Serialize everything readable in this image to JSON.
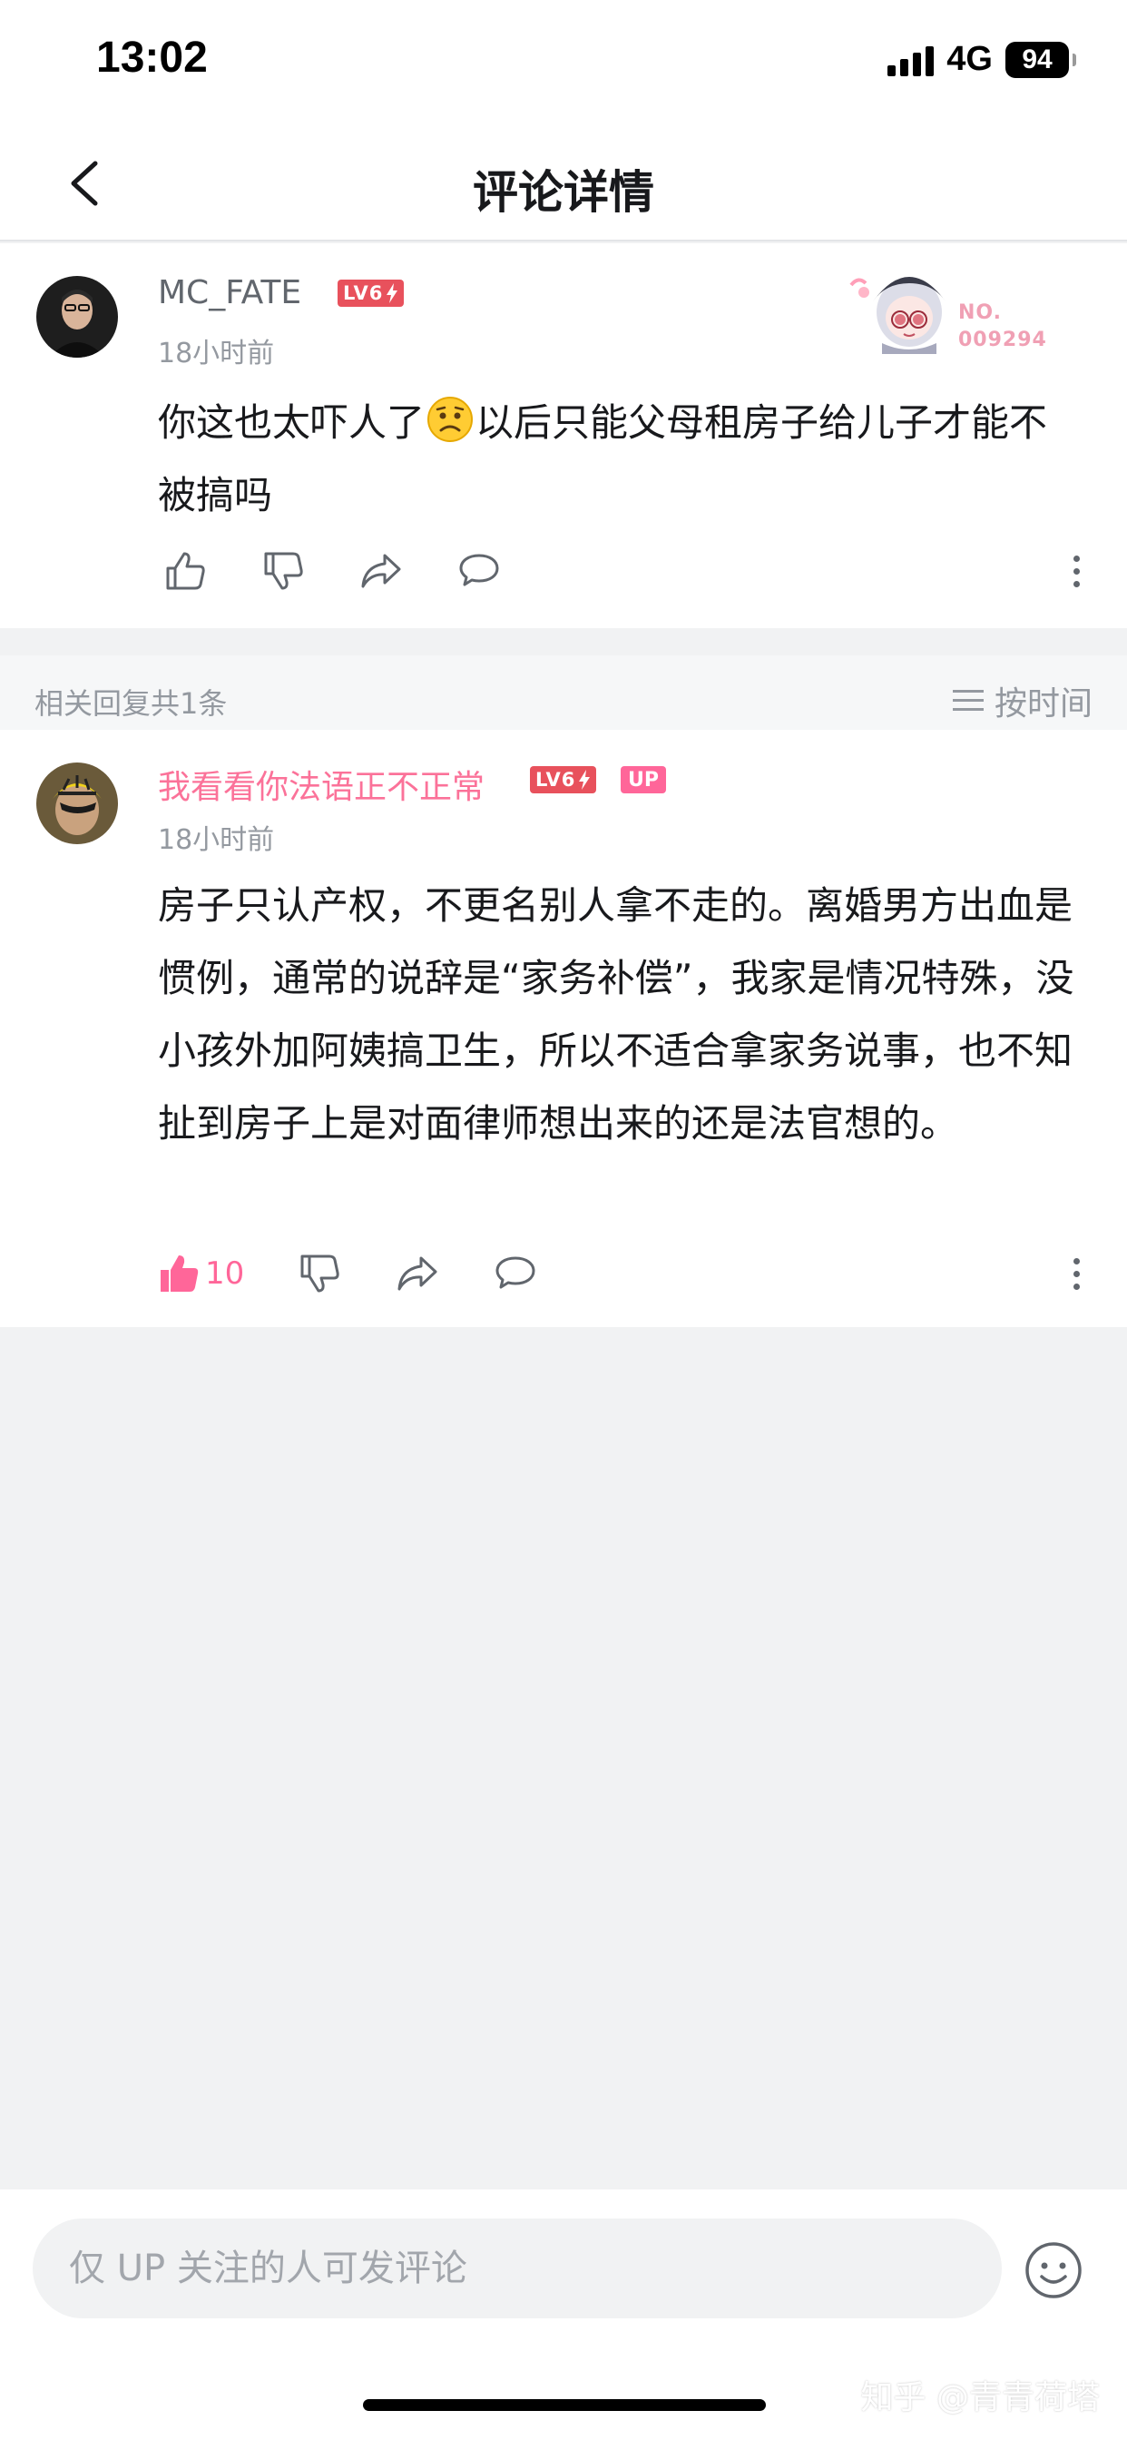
{
  "status_bar": {
    "time": "13:02",
    "network": "4G",
    "battery": "94"
  },
  "nav": {
    "title": "评论详情",
    "back_icon": "chevron-left-icon"
  },
  "main_comment": {
    "username": "MC_FATE",
    "level": "LV6",
    "time": "18小时前",
    "text_before_emoji": "你这也太吓人了",
    "emoji": "worried-face-icon",
    "text_after_emoji": "以后只能父母租房子给儿子才能不被搞吗",
    "fan_badge": {
      "label": "NO.",
      "number": "009294"
    }
  },
  "replies": {
    "count_label": "相关回复共1条",
    "sort_label": "按时间",
    "items": [
      {
        "username": "我看看你法语正不正常",
        "level": "LV6",
        "up_badge": "UP",
        "time": "18小时前",
        "text": "房子只认产权，不更名别人拿不走的。离婚男方出血是惯例，通常的说辞是“家务补偿”，我家是情况特殊，没小孩外加阿姨搞卫生，所以不适合拿家务说事，也不知扯到房子上是对面律师想出来的还是法官想的。",
        "like_count": "10"
      }
    ]
  },
  "input_bar": {
    "placeholder": "仅 UP 关注的人可发评论",
    "emoji_icon": "smiley-icon"
  },
  "watermark": "知乎 @青青荷塔",
  "colors": {
    "accent_pink": "#ff6699",
    "level_red": "#e8515c",
    "text_secondary": "#9499a0"
  }
}
